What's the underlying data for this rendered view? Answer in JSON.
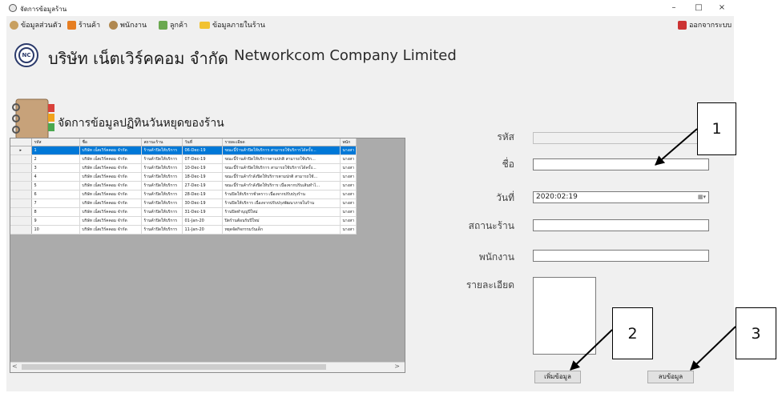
{
  "window": {
    "title": "จัดการข้อมูลร้าน",
    "controls": {
      "minimize": "–",
      "maximize": "□",
      "close": "×"
    }
  },
  "menu": {
    "items": [
      {
        "label": "ข้อมูลส่วนตัว",
        "icon": "person-icon"
      },
      {
        "label": "ร้านค้า",
        "icon": "store-icon"
      },
      {
        "label": "พนักงาน",
        "icon": "employee-icon"
      },
      {
        "label": "ลูกค้า",
        "icon": "customer-icon"
      },
      {
        "label": "ข้อมูลภายในร้าน",
        "icon": "folder-icon"
      }
    ],
    "logout_label": "ออกจากระบบ"
  },
  "header": {
    "logo_text": "NC",
    "company_th": "บริษัท เน็ตเวิร์คคอม จำกัด",
    "company_en": "Networkcom Company Limited"
  },
  "section_title": "จัดการข้อมูลปฏิทินวันหยุดของร้าน",
  "grid": {
    "columns": [
      "รหัส",
      "ชื่อ",
      "สถานะร้าน",
      "วันที่",
      "รายละเอียด",
      "พนัก"
    ],
    "selected_row_marker": "▸",
    "rows": [
      [
        "1",
        "บริษัท เน็ตเวิร์คคอม จำกัด",
        "ร้านค้าปิดให้บริการ",
        "06-Dec-19",
        "ขณะนี้ร้านค้าปิดให้บริการ สามารถใช้บริการได้ครั้ง...",
        "นางสา"
      ],
      [
        "2",
        "บริษัท เน็ตเวิร์คคอม จำกัด",
        "ร้านค้าปิดให้บริการ",
        "07-Dec-19",
        "ขณะนี้ร้านค้าปิดให้บริการตามปกติ สามารถใช้บริก...",
        "นางสา"
      ],
      [
        "3",
        "บริษัท เน็ตเวิร์คคอม จำกัด",
        "ร้านค้าปิดให้บริการ",
        "10-Dec-19",
        "ขณะนี้ร้านค้าปิดให้บริการ สามารถใช้บริการได้ครั้ง...",
        "นางสา"
      ],
      [
        "4",
        "บริษัท เน็ตเวิร์คคอม จำกัด",
        "ร้านค้าปิดให้บริการ",
        "18-Dec-19",
        "ขณะนี้ร้านค้ากำลังปิดให้บริการตามปกติ สามารถใช้...",
        "นางสา"
      ],
      [
        "5",
        "บริษัท เน็ตเวิร์คคอม จำกัด",
        "ร้านค้าปิดให้บริการ",
        "27-Dec-19",
        "ขณะนี้ร้านค้ากำลังปิดให้บริการ เนื่องจากปรับเส้นทำไ...",
        "นางสา"
      ],
      [
        "6",
        "บริษัท เน็ตเวิร์คคอม จำกัด",
        "ร้านค้าปิดให้บริการ",
        "28-Dec-19",
        "ร้านปิดให้บริการชั่วคราว เนื่องจากปรับปรุงร้าน",
        "นางสา"
      ],
      [
        "7",
        "บริษัท เน็ตเวิร์คคอม จำกัด",
        "ร้านค้าปิดให้บริการ",
        "30-Dec-19",
        "ร้านปิดให้บริการ เนื่องจากปรับปรุงพัฒนาภายในร้าน",
        "นางสา"
      ],
      [
        "8",
        "บริษัท เน็ตเวิร์คคอม จำกัด",
        "ร้านค้าปิดให้บริการ",
        "31-Dec-19",
        "ร้านปิดทำบุญปีใหม่",
        "นางสา"
      ],
      [
        "9",
        "บริษัท เน็ตเวิร์คคอม จำกัด",
        "ร้านค้าปิดให้บริการ",
        "01-Jan-20",
        "ปิดร้านต้อนรับปีใหม่",
        "นางสา"
      ],
      [
        "10",
        "บริษัท เน็ตเวิร์คคอม จำกัด",
        "ร้านค้าปิดให้บริการ",
        "11-Jan-20",
        "หยุดจัดกิจกรรมวันเด็ก",
        "นางสา"
      ]
    ],
    "scroll_left": "<",
    "scroll_right": ">"
  },
  "form": {
    "id_label": "รหัส",
    "id_value": "",
    "name_label": "ชื่อ",
    "name_value": "",
    "date_label": "วันที่",
    "date_value": "2020:02:19",
    "status_label": "สถานะร้าน",
    "status_value": "",
    "employee_label": "พนักงาน",
    "employee_value": "",
    "detail_label": "รายละเอียด",
    "detail_value": "",
    "add_button": "เพิ่มข้อมูล",
    "delete_button": "ลบข้อมูล"
  },
  "callouts": [
    "1",
    "2",
    "3"
  ]
}
